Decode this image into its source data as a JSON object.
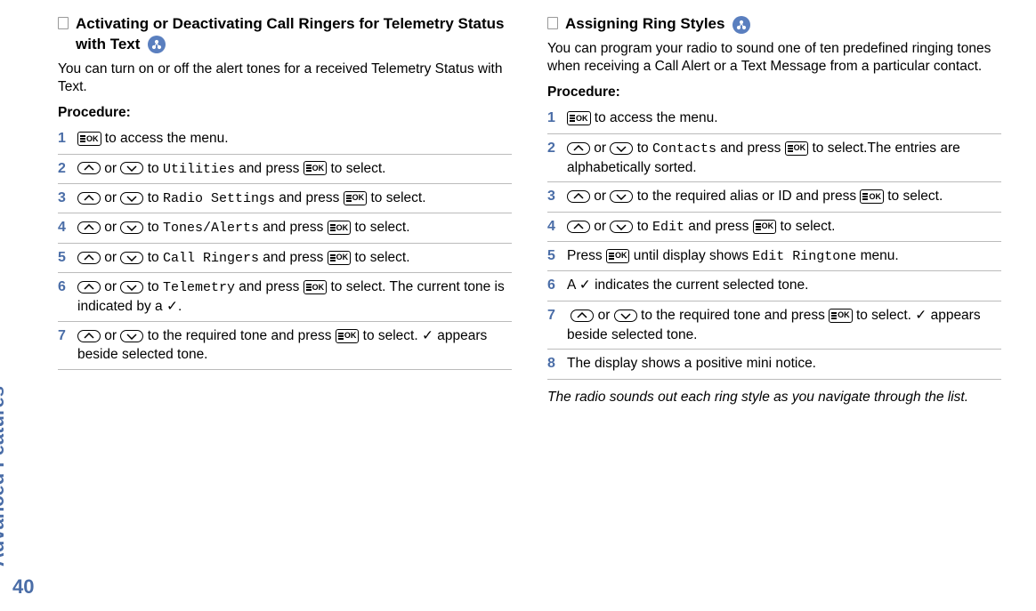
{
  "sideLabel": "Advanced Features",
  "pageNumber": "40",
  "left": {
    "heading": "Activating or Deactivating Call Ringers for Telemetry Status with Text",
    "intro": "You can turn on or off the alert tones for a received Telemetry Status with Text.",
    "procedureLabel": "Procedure:",
    "steps": {
      "s1": {
        "num": "1",
        "tail": " to access the menu."
      },
      "s2": {
        "num": "2",
        "mid": " to ",
        "menu": "Utilities",
        "after": " and press ",
        "tail": " to select."
      },
      "s3": {
        "num": "3",
        "mid": " to ",
        "menu": "Radio Settings",
        "after": " and press ",
        "tail": " to select."
      },
      "s4": {
        "num": "4",
        "mid": " to ",
        "menu": "Tones/Alerts",
        "after": " and press ",
        "tail": " to select."
      },
      "s5": {
        "num": "5",
        "mid": " to ",
        "menu": "Call Ringers",
        "after": " and press ",
        "tail": " to select."
      },
      "s6": {
        "num": "6",
        "mid": " to ",
        "menu": "Telemetry",
        "after": " and press ",
        "tail": " to select. The current tone is indicated by a ✓."
      },
      "s7": {
        "num": "7",
        "mid": " to the required tone and press ",
        "tail": " to select. ✓ appears beside selected tone."
      }
    },
    "or": " or "
  },
  "right": {
    "heading": "Assigning Ring Styles",
    "intro": "You can program your radio to sound one of ten predefined ringing tones when receiving a Call Alert or a Text Message from a particular contact.",
    "procedureLabel": "Procedure:",
    "steps": {
      "s1": {
        "num": "1",
        "tail": " to access the menu."
      },
      "s2": {
        "num": "2",
        "mid": " to ",
        "menu": "Contacts",
        "after": " and press ",
        "tail": " to select.The entries are alphabetically sorted."
      },
      "s3": {
        "num": "3",
        "mid": " to the required alias or ID and press ",
        "tail": " to select."
      },
      "s4": {
        "num": "4",
        "mid": " to ",
        "menu": "Edit",
        "after": " and press ",
        "tail": " to select."
      },
      "s5": {
        "num": "5",
        "pre": "Press ",
        "mid": " until display shows ",
        "menu": "Edit Ringtone",
        "tail": " menu."
      },
      "s6": {
        "num": "6",
        "text": "A ✓ indicates the current selected tone."
      },
      "s7": {
        "num": "7",
        "mid": " to the required tone and press ",
        "tail": " to select. ✓ appears beside selected tone."
      },
      "s8": {
        "num": "8",
        "text": "The display shows a positive mini notice."
      }
    },
    "or": " or ",
    "note": "The radio sounds out each ring style as you navigate through the list."
  },
  "keys": {
    "ok": "OK"
  }
}
